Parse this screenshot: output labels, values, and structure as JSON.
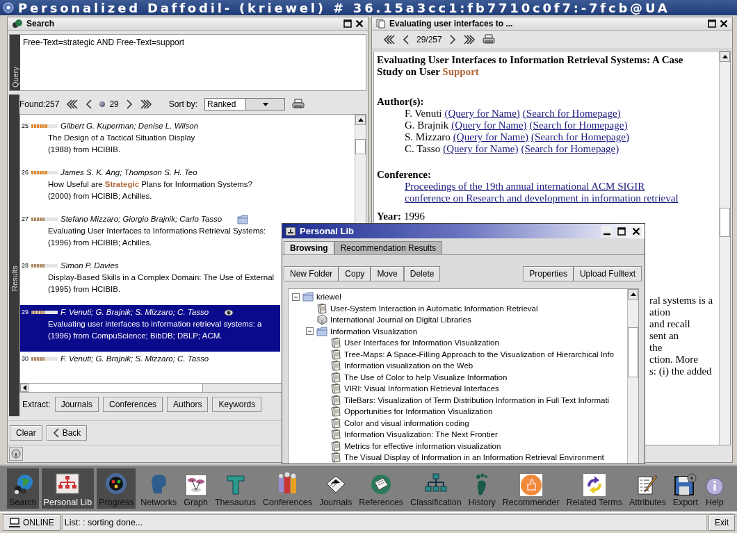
{
  "window": {
    "title": "Personalized Daffodil- (kriewel) # 36.15a3cc1:fb7710c0f7:-7fcb@UA"
  },
  "search_panel": {
    "title": "Search",
    "query_label": "Query",
    "query": "Free-Text=strategic AND Free-Text=support",
    "results_label": "Results",
    "found": "Found:257",
    "page": "29",
    "sort_label": "Sort by:",
    "sort_value": "Ranked",
    "results": [
      {
        "number": "25",
        "level": 0.6,
        "color": "#e0882c",
        "authors": "Gilbert G. Kuperman; Denise L. Wilson",
        "title": "The Design of a Tactical Situation Display",
        "source": "(1988) from HCIBIB.",
        "in_library": false,
        "viewed": false,
        "selected": false
      },
      {
        "number": "26",
        "level": 0.6,
        "color": "#e0882c",
        "authors": "James S. K. Ang; Thompson S. H. Teo",
        "title": "How Useful are **Strategic** Plans for Information Systems?",
        "source": "(2000) from HCIBIB; Achilles.",
        "in_library": false,
        "viewed": false,
        "selected": false
      },
      {
        "number": "27",
        "level": 0.5,
        "color": "#b08a64",
        "authors": "Stefano Mizzaro; Giorgio Brajnik; Carlo Tasso",
        "title": "Evaluating User Interfaces to Informations Retrieval Systems:",
        "source": "(1996) from HCIBIB; Achilles.",
        "in_library": true,
        "viewed": false,
        "selected": false
      },
      {
        "number": "28",
        "level": 0.5,
        "color": "#b08a64",
        "authors": "Simon P. Davies",
        "title": "Display-Based Skills in a Complex Domain: The Use of External",
        "source": "(1995) from HCIBIB.",
        "in_library": false,
        "viewed": false,
        "selected": false
      },
      {
        "number": "29",
        "level": 0.5,
        "color": "#b08a64",
        "authors": "F. Venuti; G. Brajnik; S. Mizzaro; C. Tasso",
        "title": "Evaluating user interfaces to information retrieval systems: a",
        "source": "(1996) from CompuScience; BibDB; DBLP; ACM.",
        "in_library": false,
        "viewed": true,
        "selected": true
      },
      {
        "number": "30",
        "level": 0.5,
        "color": "#b08a64",
        "authors": "F. Venuti; G. Brajnik; S. Mizzaro; C. Tasso",
        "in_library": false,
        "viewed": false,
        "selected": false
      }
    ],
    "extract_label": "Extract:",
    "extract_buttons": [
      "Journals",
      "Conferences",
      "Authors",
      "Keywords"
    ],
    "clear": "Clear",
    "back": "Back"
  },
  "document_panel": {
    "title": "Evaluating user interfaces to ...",
    "position": "29/257",
    "heading": "Evaluating User Interfaces to Information Retrieval Systems: A Case Study on User **Support**",
    "authors_label": "Author(s):",
    "authors": [
      {
        "name": "F. Venuti",
        "links": [
          "(Query for Name)",
          "(Search for Homepage)"
        ]
      },
      {
        "name": "G. Brajnik",
        "links": [
          "(Query for Name)",
          "(Search for Homepage)"
        ]
      },
      {
        "name": "S. Mizzaro",
        "links": [
          "(Query for Name)",
          "(Search for Homepage)"
        ]
      },
      {
        "name": "C. Tasso",
        "links": [
          "(Query for Name)",
          "(Search for Homepage)"
        ]
      }
    ],
    "conference_label": "Conference:",
    "conference": [
      "Proceedings of the 19th annual international ACM SIGIR",
      "conference on Research and development in information retrieval"
    ],
    "year_label": "Year:",
    "year": "1996",
    "abstract_fragments": [
      "ral systems is a",
      "ation",
      "and recall",
      "sent an",
      "the",
      "ction. More",
      "s: (i) the added"
    ]
  },
  "library_window": {
    "title": "Personal Lib",
    "tabs": [
      {
        "label": "Browsing",
        "selected": true
      },
      {
        "label": "Recommendation Results",
        "selected": false
      }
    ],
    "left_buttons": [
      "New Folder",
      "Copy",
      "Move",
      "Delete"
    ],
    "right_buttons": [
      "Properties",
      "Upload Fulltext"
    ],
    "tree": [
      {
        "label": "kriewel",
        "kind": "folder",
        "expanded": true,
        "children": [
          {
            "label": "User-System Interaction in Automatic Information Retrieval",
            "kind": "document"
          },
          {
            "label": "International Journal on Digital Libraries",
            "kind": "journal"
          },
          {
            "label": "Information Visualization",
            "kind": "folder",
            "expanded": true,
            "children": [
              {
                "label": "User Interfaces for Information Visualization",
                "kind": "document"
              },
              {
                "label": "Tree-Maps: A Space-Filling Approach to the Visualization of Hierarchical Info",
                "kind": "document"
              },
              {
                "label": "Information visualization on the Web",
                "kind": "document"
              },
              {
                "label": "The Use of Color to help Visualize Information",
                "kind": "document"
              },
              {
                "label": "VIRI: Visual Information Retrieval Interfaces",
                "kind": "document"
              },
              {
                "label": "TileBars: Visualization of Term Distribution Information in Full Text Informati",
                "kind": "document"
              },
              {
                "label": "Opportunities for Information Visualization",
                "kind": "document"
              },
              {
                "label": "Color and visual information coding",
                "kind": "document"
              },
              {
                "label": "Information Visualization: The Next Frontier",
                "kind": "document"
              },
              {
                "label": "Metrics for effective information visualization",
                "kind": "document"
              },
              {
                "label": "The Visual Display of Information in an Information Retrieval Environment",
                "kind": "document"
              }
            ]
          }
        ]
      }
    ]
  },
  "toolbar": [
    {
      "label": "Search",
      "open": true,
      "selected": false
    },
    {
      "label": "Personal Lib",
      "open": true,
      "selected": true
    },
    {
      "label": "Progress",
      "open": true,
      "selected": false
    },
    {
      "label": "Networks",
      "open": false,
      "selected": false
    },
    {
      "label": "Graph",
      "open": false,
      "selected": false
    },
    {
      "label": "Thesaurus",
      "open": false,
      "selected": false
    },
    {
      "label": "Conferences",
      "open": false,
      "selected": false
    },
    {
      "label": "Journals",
      "open": false,
      "selected": false
    },
    {
      "label": "References",
      "open": false,
      "selected": false
    },
    {
      "label": "Classification",
      "open": false,
      "selected": false
    },
    {
      "label": "History",
      "open": false,
      "selected": false
    },
    {
      "label": "Recommender",
      "open": false,
      "selected": false
    },
    {
      "label": "Related Terms",
      "open": false,
      "selected": false
    },
    {
      "label": "Attributes",
      "open": false,
      "selected": false
    },
    {
      "label": "Export",
      "open": false,
      "selected": false
    },
    {
      "label": "Help",
      "open": false,
      "selected": false
    }
  ],
  "status_bar": {
    "connection": "ONLINE",
    "message": "List: : sorting done...",
    "exit": "Exit"
  }
}
